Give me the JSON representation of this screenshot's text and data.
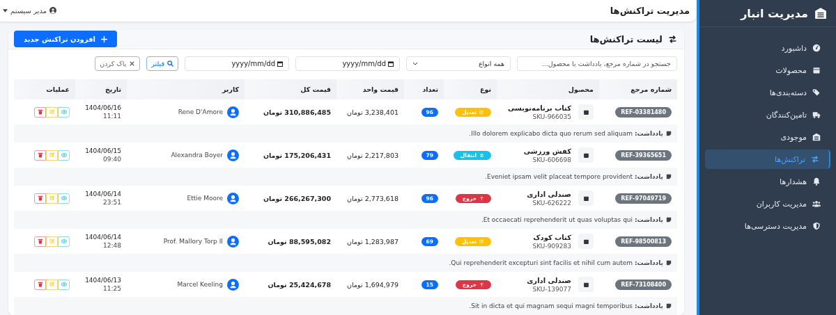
{
  "sidebar": {
    "title": "مدیریت انبار",
    "items": [
      {
        "label": "داشبورد",
        "selected": false
      },
      {
        "label": "محصولات",
        "selected": false
      },
      {
        "label": "دسته‌بندی‌ها",
        "selected": false
      },
      {
        "label": "تامین‌کنندگان",
        "selected": false
      },
      {
        "label": "موجودی",
        "selected": false
      },
      {
        "label": "تراکنش‌ها",
        "selected": true
      },
      {
        "label": "هشدارها",
        "selected": false
      },
      {
        "label": "مدیریت کاربران",
        "selected": false
      },
      {
        "label": "مدیریت دسترسی‌ها",
        "selected": false
      }
    ]
  },
  "header": {
    "title": "مدیریت تراکنش‌ها",
    "user": "مدیر سیستم"
  },
  "card": {
    "title": "لیست تراکنش‌ها",
    "add_button": "افزودن تراکنش جدید"
  },
  "filters": {
    "search": {
      "placeholder": "جستجو در شماره مرجع، یادداشت یا محصول..."
    },
    "type_select": "همه انواع",
    "date_from": {
      "placeholder": "yyyy/mm/dd"
    },
    "date_to": {
      "placeholder": "yyyy/mm/dd"
    },
    "filter_button": "فیلتر",
    "clear_button": "پاک کردن"
  },
  "table": {
    "columns": [
      "شماره مرجع",
      "محصول",
      "نوع",
      "تعداد",
      "قیمت واحد",
      "قیمت کل",
      "کاربر",
      "تاریخ",
      "عملیات"
    ],
    "rows": [
      {
        "ref": "REF-03381480",
        "product": "کتاب برنامه‌نویسی",
        "sku": "SKU-966035",
        "type": {
          "kind": "adjust",
          "label": "تعدیل"
        },
        "qty": "96",
        "unit_price": "3,238,401 تومان",
        "total": "310,886,485 تومان",
        "user": "Rene D'Amore",
        "date": "1404/06/16",
        "time": "11:11",
        "note": "**یادداشت:** Illo dolorem explicabo dicta quo rerum sed aliquam."
      },
      {
        "ref": "REF-39365651",
        "product": "کفش ورزشی",
        "sku": "SKU-606698",
        "type": {
          "kind": "transfer",
          "label": "انتقال"
        },
        "qty": "79",
        "unit_price": "2,217,803 تومان",
        "total": "175,206,431 تومان",
        "user": "Alexandra Boyer",
        "date": "1404/06/15",
        "time": "09:40",
        "note": "**یادداشت:** Eveniet ipsam velit placeat tempore provident."
      },
      {
        "ref": "REF-97049719",
        "product": "صندلی اداری",
        "sku": "SKU-626222",
        "type": {
          "kind": "out",
          "label": "خروج"
        },
        "qty": "96",
        "unit_price": "2,773,618 تومان",
        "total": "266,267,300 تومان",
        "user": "Ettie Moore",
        "date": "1404/06/14",
        "time": "23:51",
        "note": "**یادداشت:** Et occaecati reprehenderit ut quas voluptas qui."
      },
      {
        "ref": "REF-98500813",
        "product": "کتاب کودک",
        "sku": "SKU-909283",
        "type": {
          "kind": "adjust",
          "label": "تعدیل"
        },
        "qty": "69",
        "unit_price": "1,283,987 تومان",
        "total": "88,595,082 تومان",
        "user": "Prof. Mallory Torp II",
        "date": "1404/06/14",
        "time": "12:48",
        "note": "**یادداشت:** Qui reprehenderit excepturi sint facilis et nihil cum autem."
      },
      {
        "ref": "REF-73108400",
        "product": "صندلی اداری",
        "sku": "SKU-139077",
        "type": {
          "kind": "out",
          "label": "خروج"
        },
        "qty": "15",
        "unit_price": "1,694,979 تومان",
        "total": "25,424,678 تومان",
        "user": "Marcel Keeling",
        "date": "1404/06/13",
        "time": "11:25",
        "note": "**یادداشت:** Sit in dicta et qui magnam sequi magni temporibus."
      }
    ]
  }
}
